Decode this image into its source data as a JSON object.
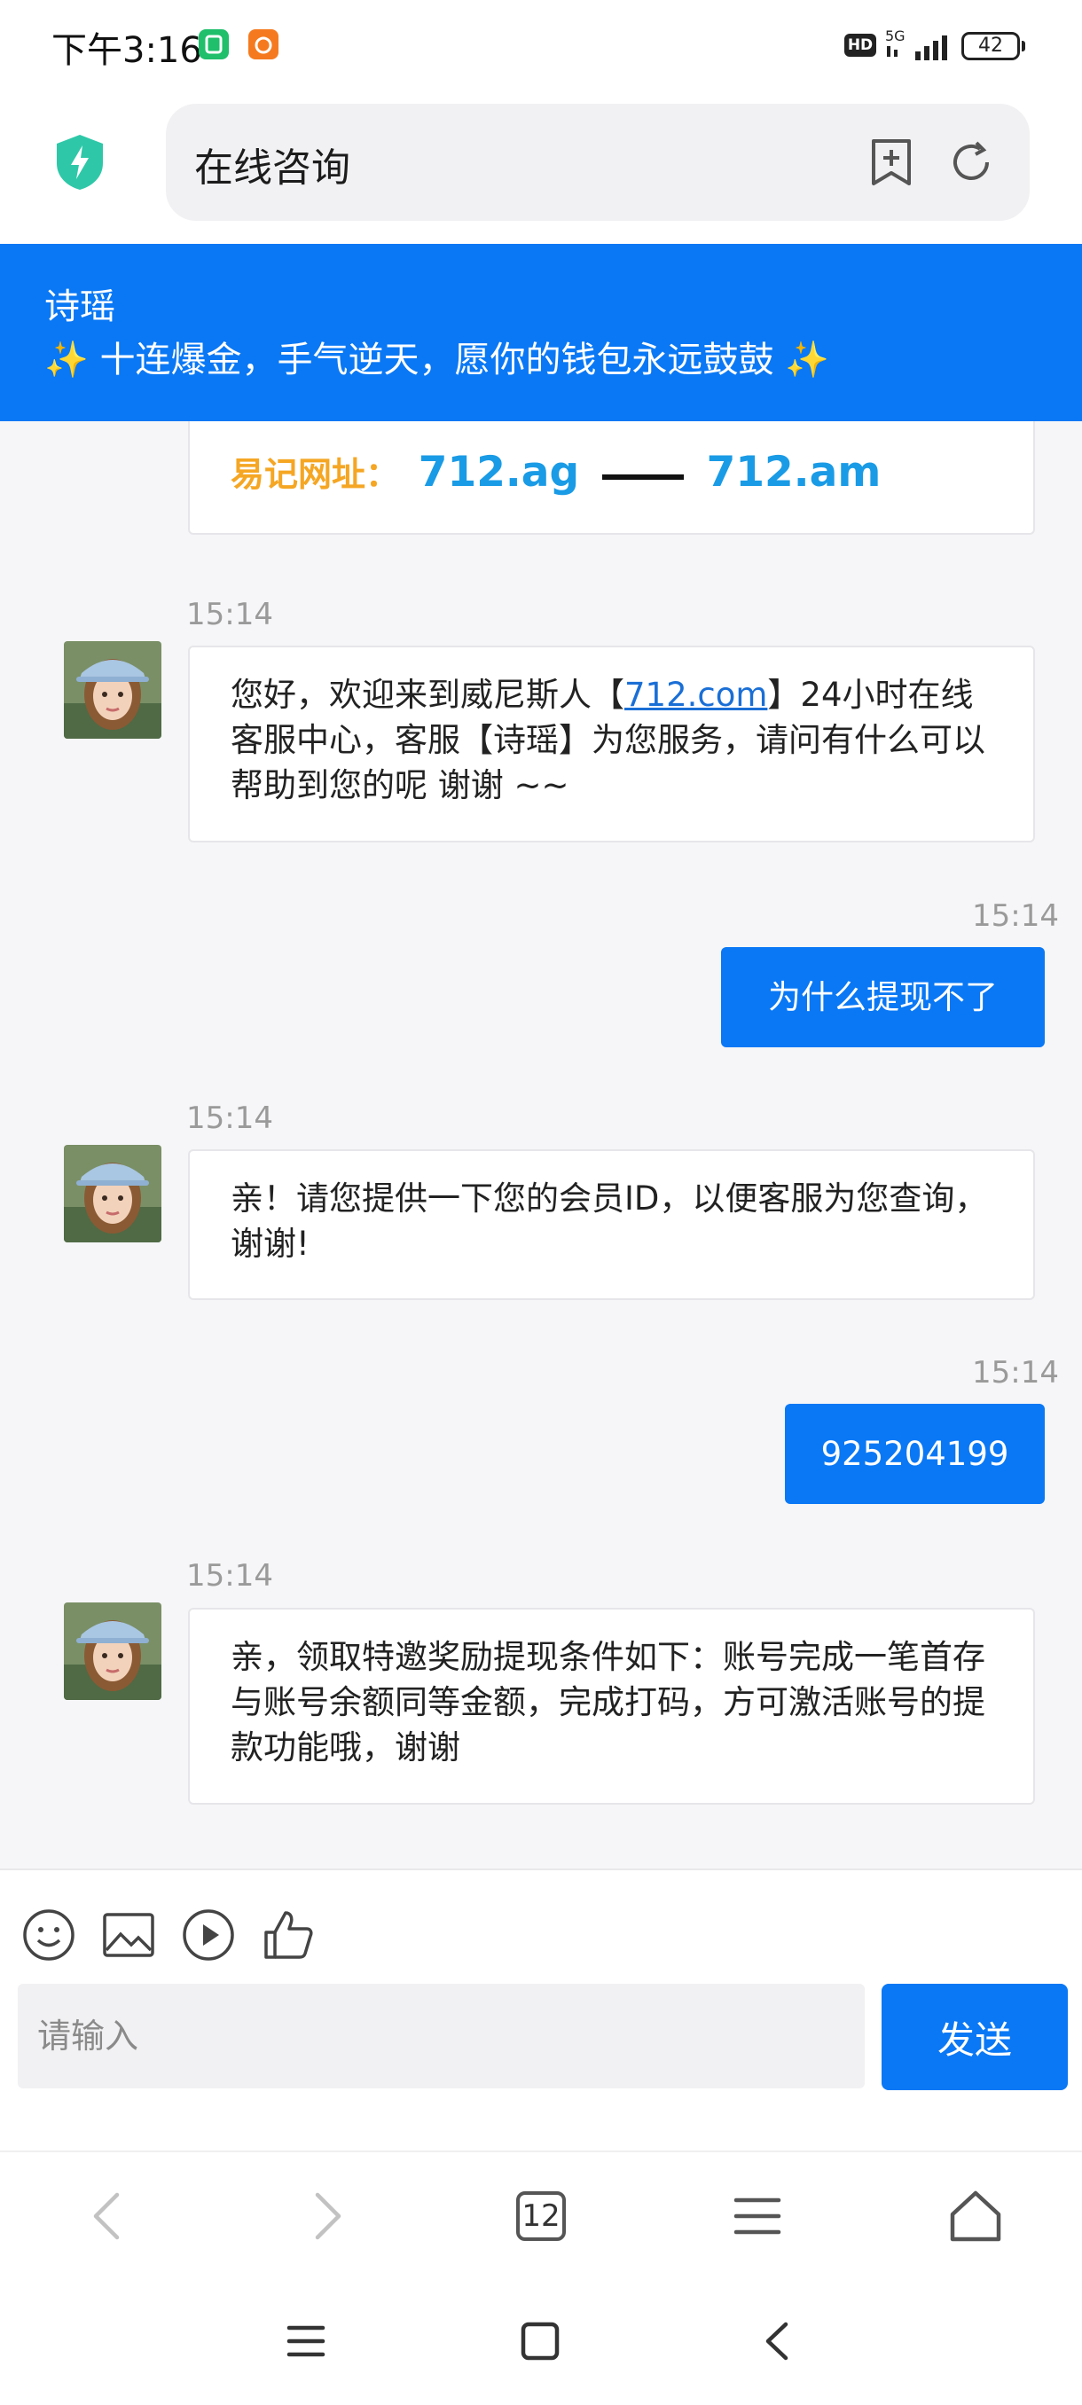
{
  "status_bar": {
    "time": "下午3:16",
    "network": "5G",
    "battery": "42",
    "hd_label": "HD"
  },
  "browser": {
    "page_title": "在线咨询",
    "tab_count": "12"
  },
  "chat_header": {
    "agent_name": "诗瑶",
    "slogan": "✨ 十连爆金，手气逆天，愿你的钱包永远鼓鼓 ✨"
  },
  "address_card": {
    "label": "易记网址",
    "colon": "：",
    "domain1": "712.ag",
    "domain2": "712.am"
  },
  "messages": [
    {
      "time": "15:14",
      "part1": "您好，欢迎来到威尼斯人【",
      "link": "712.com",
      "part2": "】24小时在线客服中心，客服【诗瑶】为您服务，请问有什么可以帮助到您的呢 谢谢 ~~"
    },
    {
      "time": "15:14",
      "text": "为什么提现不了"
    },
    {
      "time": "15:14",
      "text": "亲！请您提供一下您的会员ID，以便客服为您查询，谢谢!"
    },
    {
      "time": "15:14",
      "text": "925204199"
    },
    {
      "time": "15:14",
      "text": "亲，领取特邀奖励提现条件如下：账号完成一笔首存与账号余额同等金额，完成打码，方可激活账号的提款功能哦，谢谢"
    }
  ],
  "input": {
    "placeholder": "请输入",
    "send_label": "发送"
  },
  "colors": {
    "primary": "#0a78f5",
    "address_label": "#f5a623",
    "address_link": "#1a9be6",
    "chat_background": "#f6f6f8"
  },
  "icons": {
    "toolbar": [
      "emoji-icon",
      "image-icon",
      "video-icon",
      "thumbs-up-icon"
    ],
    "browser_nav": [
      "back-icon",
      "forward-icon",
      "tabs-icon",
      "menu-icon",
      "home-icon"
    ],
    "system_nav": [
      "recents-icon",
      "home-square-icon",
      "back-triangle-icon"
    ]
  }
}
